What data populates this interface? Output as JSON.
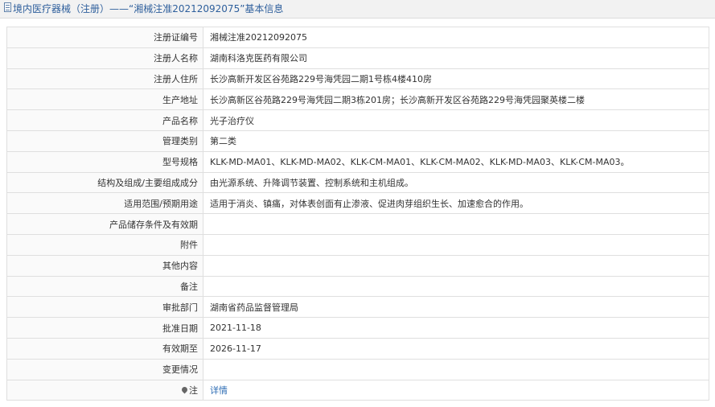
{
  "header": {
    "title": "境内医疗器械（注册）——“湘械注准20212092075”基本信息"
  },
  "fields": [
    {
      "label": "注册证编号",
      "value": "湘械注准20212092075"
    },
    {
      "label": "注册人名称",
      "value": "湖南科洛克医药有限公司"
    },
    {
      "label": "注册人住所",
      "value": "长沙高新开发区谷苑路229号海凭园二期1号栋4楼410房"
    },
    {
      "label": "生产地址",
      "value": "长沙高新区谷苑路229号海凭园二期3栋201房；长沙高新开发区谷苑路229号海凭园聚英楼二楼"
    },
    {
      "label": "产品名称",
      "value": "光子治疗仪"
    },
    {
      "label": "管理类别",
      "value": "第二类"
    },
    {
      "label": "型号规格",
      "value": "KLK-MD-MA01、KLK-MD-MA02、KLK-CM-MA01、KLK-CM-MA02、KLK-MD-MA03、KLK-CM-MA03。"
    },
    {
      "label": "结构及组成/主要组成成分",
      "value": "由光源系统、升降调节装置、控制系统和主机组成。"
    },
    {
      "label": "适用范围/预期用途",
      "value": "适用于消炎、镇痛，对体表创面有止渗液、促进肉芽组织生长、加速愈合的作用。"
    },
    {
      "label": "产品储存条件及有效期",
      "value": ""
    },
    {
      "label": "附件",
      "value": ""
    },
    {
      "label": "其他内容",
      "value": ""
    },
    {
      "label": "备注",
      "value": ""
    },
    {
      "label": "审批部门",
      "value": "湖南省药品监督管理局"
    },
    {
      "label": "批准日期",
      "value": "2021-11-18"
    },
    {
      "label": "有效期至",
      "value": "2026-11-17"
    },
    {
      "label": "变更情况",
      "value": ""
    }
  ],
  "note": {
    "label": "注",
    "link_text": "详情",
    "link_color": "#2e6db4"
  }
}
